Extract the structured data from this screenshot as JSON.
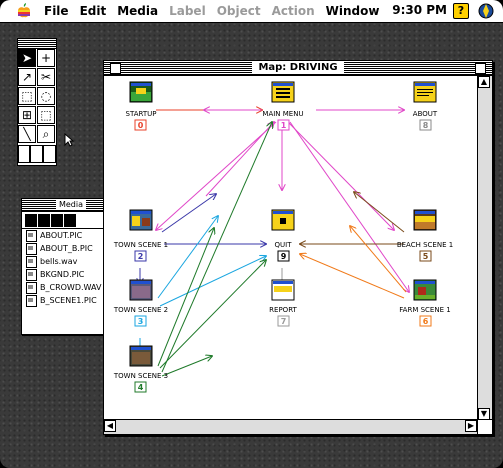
{
  "menubar": {
    "items": [
      {
        "label": "File",
        "enabled": true
      },
      {
        "label": "Edit",
        "enabled": true
      },
      {
        "label": "Media",
        "enabled": true
      },
      {
        "label": "Label",
        "enabled": false
      },
      {
        "label": "Object",
        "enabled": false
      },
      {
        "label": "Action",
        "enabled": false
      },
      {
        "label": "Window",
        "enabled": true
      }
    ],
    "clock": "9:30 PM",
    "help_glyph": "?"
  },
  "media_window": {
    "title": "Media",
    "files": [
      "ABOUT.PIC",
      "ABOUT_B.PIC",
      "bells.wav",
      "BKGND.PIC",
      "B_CROWD.WAV",
      "B_SCENE1.PIC"
    ]
  },
  "map_window": {
    "title": "Map: DRIVING",
    "nodes": [
      {
        "id": "startup",
        "label": "STARTUP",
        "badge": "0",
        "badge_color": "#e8412a"
      },
      {
        "id": "mainmenu",
        "label": "MAIN MENU",
        "badge": "1",
        "badge_color": "#e047c8"
      },
      {
        "id": "about",
        "label": "ABOUT",
        "badge": "8",
        "badge_color": "#8a8a8a"
      },
      {
        "id": "town1",
        "label": "TOWN SCENE 1",
        "badge": "2",
        "badge_color": "#3a37a8"
      },
      {
        "id": "quit",
        "label": "QUIT",
        "badge": "9",
        "badge_color": "#000000"
      },
      {
        "id": "beach",
        "label": "BEACH SCENE 1",
        "badge": "5",
        "badge_color": "#7a4a1a"
      },
      {
        "id": "town2",
        "label": "TOWN SCENE 2",
        "badge": "3",
        "badge_color": "#1aa6e0"
      },
      {
        "id": "report",
        "label": "REPORT",
        "badge": "7",
        "badge_color": "#9a9a9a"
      },
      {
        "id": "farm",
        "label": "FARM SCENE 1",
        "badge": "6",
        "badge_color": "#f07a1a"
      },
      {
        "id": "town3",
        "label": "TOWN SCENE 3",
        "badge": "4",
        "badge_color": "#1f7a2a"
      }
    ]
  },
  "colors": {
    "startup_link": "#e8412a",
    "menu_link": "#e047c8",
    "town1_link": "#3a37a8",
    "town2_link": "#1aa6e0",
    "town3_link": "#1f7a2a",
    "beach_link": "#7a4a1a",
    "farm_link": "#f07a1a",
    "quit_link": "#9a9a9a"
  }
}
